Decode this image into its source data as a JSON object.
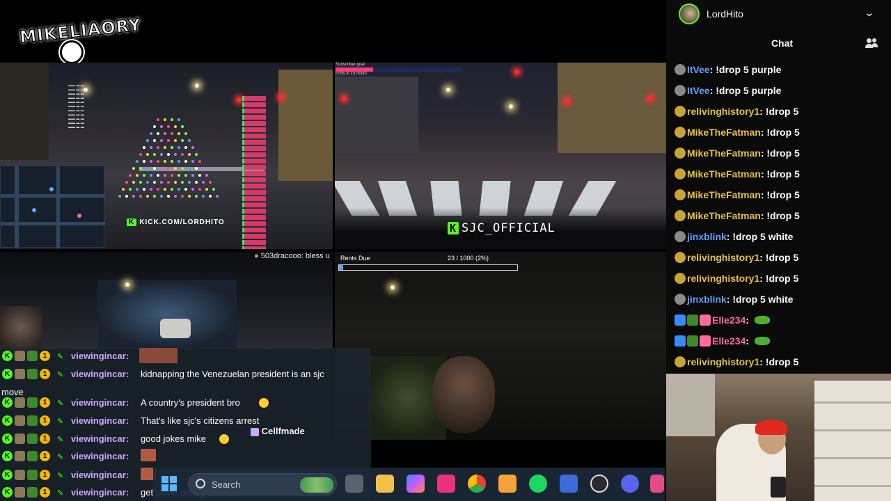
{
  "logo": {
    "text": "MIKELIAORY"
  },
  "streams": {
    "top_left_tag": "KICK.COM/LORDHITO",
    "top_right_tag": "SJC_OFFICIAL",
    "sub_goal_label": "Subscriber goal:",
    "sub_goal_ends": "Ends in 15 hours",
    "sub_goal_fraction": 0.3,
    "donation": "503dracooo: bless u",
    "rents_label": "Rents Due",
    "rents_value": "23 / 1000 (2%)",
    "rents_fraction": 0.023
  },
  "overlay_chat": {
    "rows": [
      {
        "user": "viewingincar:",
        "msg": ""
      },
      {
        "user": "viewingincar:",
        "msg": "kidnapping the Venezuelan president is an sjc"
      },
      {
        "user": "",
        "msg": "move"
      },
      {
        "user": "viewingincar:",
        "msg": "A country's president bro"
      },
      {
        "user": "viewingincar:",
        "msg": "That's like sjc's citizens arrest"
      },
      {
        "user": "viewingincar:",
        "msg": "good jokes mike"
      },
      {
        "user": "viewingincar:",
        "msg": ""
      },
      {
        "user": "viewingincar:",
        "msg": ""
      },
      {
        "user": "viewingincar:",
        "msg": "get some dennys"
      }
    ],
    "badge_number": "1",
    "badge_k": "K",
    "cellfmade": "Cellfmade"
  },
  "taskbar": {
    "search_placeholder": "Search"
  },
  "sidebar": {
    "username": "LordHito",
    "title": "Chat",
    "messages": [
      {
        "user": "ItVee",
        "msg": "!drop 5 purple",
        "color": "#5aa0ff"
      },
      {
        "user": "ItVee",
        "msg": "!drop 5 purple",
        "color": "#5aa0ff"
      },
      {
        "user": "relivinghistory1",
        "msg": "!drop 5",
        "color": "#e8c13a"
      },
      {
        "user": "MikeTheFatman",
        "msg": "!drop 5",
        "color": "#e8c13a"
      },
      {
        "user": "MikeTheFatman",
        "msg": "!drop 5",
        "color": "#e8c13a"
      },
      {
        "user": "MikeTheFatman",
        "msg": "!drop 5",
        "color": "#e8c13a"
      },
      {
        "user": "MikeTheFatman",
        "msg": "!drop 5",
        "color": "#e8c13a"
      },
      {
        "user": "MikeTheFatman",
        "msg": "!drop 5",
        "color": "#e8c13a"
      },
      {
        "user": "jinxblink",
        "msg": "!drop 5 white",
        "color": "#5aa0ff"
      },
      {
        "user": "relivinghistory1",
        "msg": "!drop 5",
        "color": "#e8c13a"
      },
      {
        "user": "relivinghistory1",
        "msg": "!drop 5",
        "color": "#e8c13a"
      },
      {
        "user": "jinxblink",
        "msg": "!drop 5 white",
        "color": "#5aa0ff"
      },
      {
        "user": "Elle234",
        "msg": "",
        "color": "#ff6b9e"
      },
      {
        "user": "Elle234",
        "msg": "",
        "color": "#ff6b9e"
      },
      {
        "user": "relivinghistory1",
        "msg": "!drop 5",
        "color": "#e8c13a"
      }
    ]
  },
  "colors": {
    "kick_green": "#53fc18",
    "chat_purple": "#c8a8ff"
  }
}
